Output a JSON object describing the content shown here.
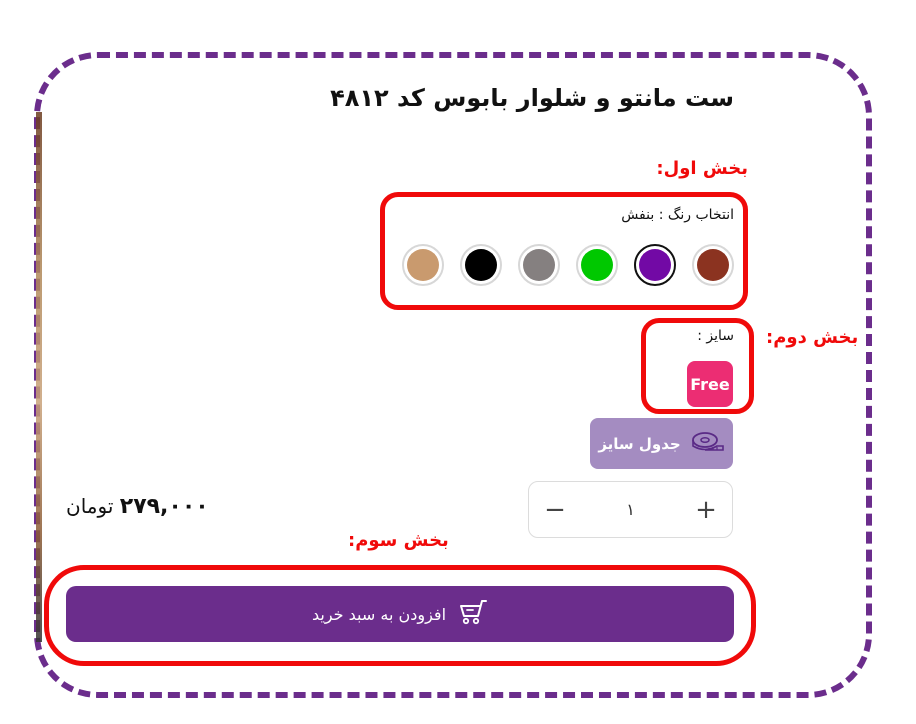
{
  "product": {
    "title": "ست مانتو و شلوار بابوس کد ۴۸۱۲"
  },
  "annotations": {
    "part1": "بخش اول:",
    "part2": "بخش دوم:",
    "part3": "بخش سوم:"
  },
  "color_selector": {
    "label": "انتخاب رنگ : بنفش",
    "selected": "purple",
    "swatches": [
      {
        "name": "brown",
        "hex": "#8b3320"
      },
      {
        "name": "purple",
        "hex": "#7209a5"
      },
      {
        "name": "green",
        "hex": "#00c800"
      },
      {
        "name": "gray",
        "hex": "#858080"
      },
      {
        "name": "black",
        "hex": "#000000"
      },
      {
        "name": "tan",
        "hex": "#c99a6e"
      }
    ]
  },
  "size_selector": {
    "label": "سایز :",
    "options": [
      "Free"
    ]
  },
  "size_chart": {
    "label": "جدول سایز",
    "icon": "measuring-tape-icon"
  },
  "quantity": {
    "value": "۱",
    "plus": "+",
    "minus": "−"
  },
  "price": {
    "amount": "۲۷۹,۰۰۰",
    "currency": "تومان"
  },
  "cart": {
    "label": "افزودن به سبد خرید",
    "icon": "cart-icon"
  },
  "colors": {
    "brand": "#6b2d8c",
    "highlight": "#f00a0a",
    "size_selected": "#ec2d73",
    "size_chart_bg": "#a48cc1"
  }
}
